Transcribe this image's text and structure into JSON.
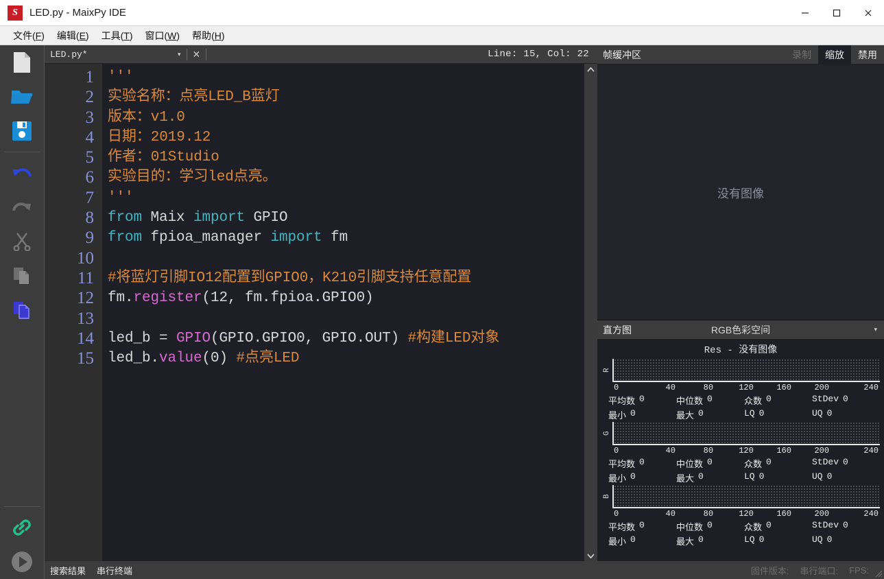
{
  "window": {
    "logo_letter": "S",
    "title": "LED.py - MaixPy IDE",
    "minimize": "─",
    "maximize": "☐",
    "close": "✕"
  },
  "menubar": {
    "items": [
      {
        "name": "file",
        "text": "文件",
        "accel": "F"
      },
      {
        "name": "edit",
        "text": "编辑",
        "accel": "E"
      },
      {
        "name": "tools",
        "text": "工具",
        "accel": "T"
      },
      {
        "name": "window",
        "text": "窗口",
        "accel": "W"
      },
      {
        "name": "help",
        "text": "帮助",
        "accel": "H"
      }
    ]
  },
  "toolbar": {
    "items": [
      {
        "name": "new-file-icon",
        "label": "新建"
      },
      {
        "name": "open-folder-icon",
        "label": "打开"
      },
      {
        "name": "save-icon",
        "label": "保存"
      },
      {
        "name": "undo-icon",
        "label": "撤销"
      },
      {
        "name": "redo-icon",
        "label": "重做"
      },
      {
        "name": "cut-icon",
        "label": "剪切"
      },
      {
        "name": "copy-icon",
        "label": "复制"
      },
      {
        "name": "paste-icon",
        "label": "粘贴"
      },
      {
        "name": "connect-icon",
        "label": "连接"
      },
      {
        "name": "run-icon",
        "label": "运行"
      }
    ]
  },
  "editor": {
    "tab_name": "LED.py*",
    "caret": "▾",
    "close": "✕",
    "cursor_status": "Line: 15, Col: 22",
    "line_numbers": [
      "1",
      "2",
      "3",
      "4",
      "5",
      "6",
      "7",
      "8",
      "9",
      "10",
      "11",
      "12",
      "13",
      "14",
      "15"
    ],
    "lines": [
      {
        "n": 1,
        "segs": [
          {
            "t": "'''",
            "c": "cmt"
          }
        ]
      },
      {
        "n": 2,
        "segs": [
          {
            "t": "实验名称：点亮LED_B蓝灯",
            "c": "cmt"
          }
        ]
      },
      {
        "n": 3,
        "segs": [
          {
            "t": "版本：v1.0",
            "c": "cmt"
          }
        ]
      },
      {
        "n": 4,
        "segs": [
          {
            "t": "日期：2019.12",
            "c": "cmt"
          }
        ]
      },
      {
        "n": 5,
        "segs": [
          {
            "t": "作者：01Studio",
            "c": "cmt"
          }
        ]
      },
      {
        "n": 6,
        "segs": [
          {
            "t": "实验目的：学习led点亮。",
            "c": "cmt"
          }
        ]
      },
      {
        "n": 7,
        "segs": [
          {
            "t": "'''",
            "c": "cmt"
          }
        ]
      },
      {
        "n": 8,
        "segs": [
          {
            "t": "from",
            "c": "kw"
          },
          {
            "t": " Maix ",
            "c": ""
          },
          {
            "t": "import",
            "c": "kw"
          },
          {
            "t": " GPIO",
            "c": ""
          }
        ]
      },
      {
        "n": 9,
        "segs": [
          {
            "t": "from",
            "c": "kw"
          },
          {
            "t": " fpioa_manager ",
            "c": ""
          },
          {
            "t": "import",
            "c": "kw"
          },
          {
            "t": " fm",
            "c": ""
          }
        ]
      },
      {
        "n": 10,
        "segs": [
          {
            "t": "",
            "c": ""
          }
        ]
      },
      {
        "n": 11,
        "segs": [
          {
            "t": "#将蓝灯引脚IO12配置到GPIO0，K210引脚支持任意配置",
            "c": "cmt"
          }
        ]
      },
      {
        "n": 12,
        "segs": [
          {
            "t": "fm.",
            "c": ""
          },
          {
            "t": "register",
            "c": "fn"
          },
          {
            "t": "(12, fm.fpioa.GPIO0)",
            "c": ""
          }
        ]
      },
      {
        "n": 13,
        "segs": [
          {
            "t": "",
            "c": ""
          }
        ]
      },
      {
        "n": 14,
        "segs": [
          {
            "t": "led_b = ",
            "c": ""
          },
          {
            "t": "GPIO",
            "c": "fn"
          },
          {
            "t": "(GPIO.GPIO0, GPIO.OUT) ",
            "c": ""
          },
          {
            "t": "#构建LED对象",
            "c": "cmt"
          }
        ]
      },
      {
        "n": 15,
        "segs": [
          {
            "t": "led_b.",
            "c": ""
          },
          {
            "t": "value",
            "c": "fn"
          },
          {
            "t": "(0) ",
            "c": ""
          },
          {
            "t": "#点亮LED",
            "c": "cmt"
          }
        ]
      }
    ]
  },
  "bottom_tabs": [
    {
      "name": "search-results",
      "label": "搜索结果"
    },
    {
      "name": "serial-terminal",
      "label": "串行终端"
    }
  ],
  "framebuffer": {
    "title": "帧缓冲区",
    "buttons": [
      {
        "name": "record",
        "label": "录制",
        "state": "disabled"
      },
      {
        "name": "zoom",
        "label": "缩放",
        "state": "active"
      },
      {
        "name": "disable",
        "label": "禁用",
        "state": "normal"
      }
    ],
    "empty_text": "没有图像"
  },
  "histogram": {
    "tab_label": "直方图",
    "mode_label": "RGB色彩空间",
    "caret": "▾",
    "resolution_text": "Res - 没有图像",
    "tick_labels": [
      "0",
      "40",
      "80",
      "120",
      "160",
      "200",
      "240"
    ],
    "stat_labels": {
      "mean": "平均数",
      "median": "中位数",
      "mode": "众数",
      "stdev": "StDev",
      "min": "最小",
      "max": "最大",
      "lq": "LQ",
      "uq": "UQ"
    },
    "channels": [
      {
        "name": "R",
        "mean": "0",
        "median": "0",
        "mode": "0",
        "stdev": "0",
        "min": "0",
        "max": "0",
        "lq": "0",
        "uq": "0"
      },
      {
        "name": "G",
        "mean": "0",
        "median": "0",
        "mode": "0",
        "stdev": "0",
        "min": "0",
        "max": "0",
        "lq": "0",
        "uq": "0"
      },
      {
        "name": "B",
        "mean": "0",
        "median": "0",
        "mode": "0",
        "stdev": "0",
        "min": "0",
        "max": "0",
        "lq": "0",
        "uq": "0"
      }
    ]
  },
  "statusbar": {
    "firmware_label": "固件版本:",
    "serial_label": "串行端口:",
    "fps_label": "FPS:"
  },
  "colors": {
    "accent_blue": "#1a8fd8",
    "comment_orange": "#d98a3a",
    "keyword_cyan": "#44b6c0",
    "function_magenta": "#d76ad0",
    "linenum_blue": "#8792d8",
    "connect_green": "#22c08a",
    "editor_bg": "#1e1e26",
    "chrome_bg": "#3c3c3c"
  }
}
